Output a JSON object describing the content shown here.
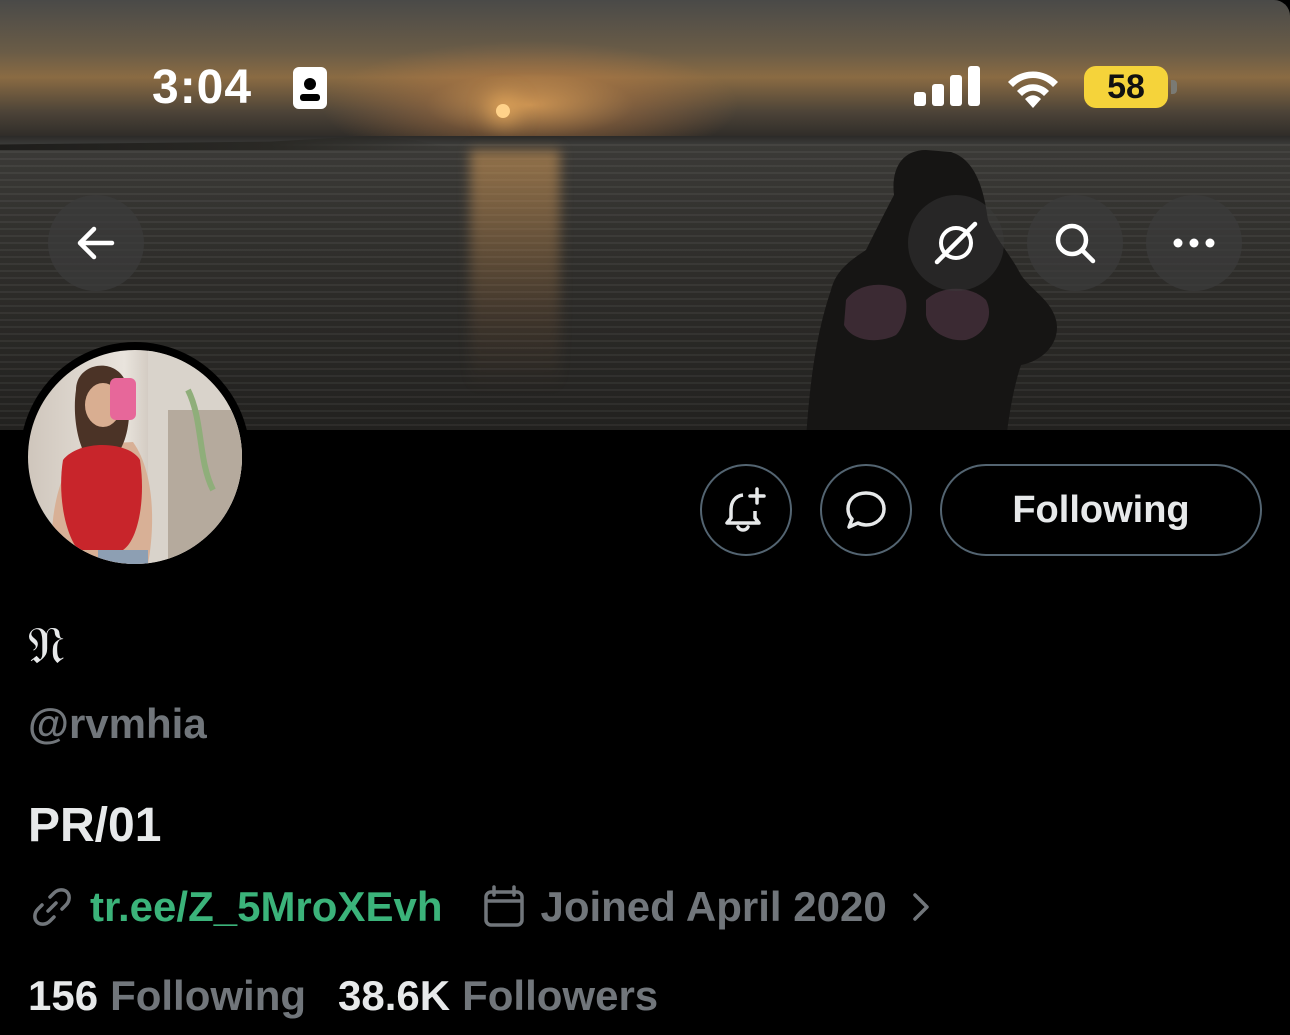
{
  "status_bar": {
    "time": "3:04",
    "battery": "58",
    "battery_color": "#f5d33a"
  },
  "header": {
    "back_icon": "arrow-left-icon",
    "grok_icon": "grok-icon",
    "search_icon": "search-icon",
    "more_icon": "more-horizontal-icon"
  },
  "actions": {
    "notify_icon": "bell-plus-icon",
    "message_icon": "message-bubble-icon",
    "following_label": "Following"
  },
  "profile": {
    "display_name": "𝔑",
    "handle": "@rvmhia",
    "bio": "PR/01",
    "link": "tr.ee/Z_5MroXEvh",
    "link_color": "#3bb37a",
    "joined": "Joined April 2020",
    "following_count": "156",
    "following_label": "Following",
    "followers_count": "38.6K",
    "followers_label": "Followers"
  }
}
